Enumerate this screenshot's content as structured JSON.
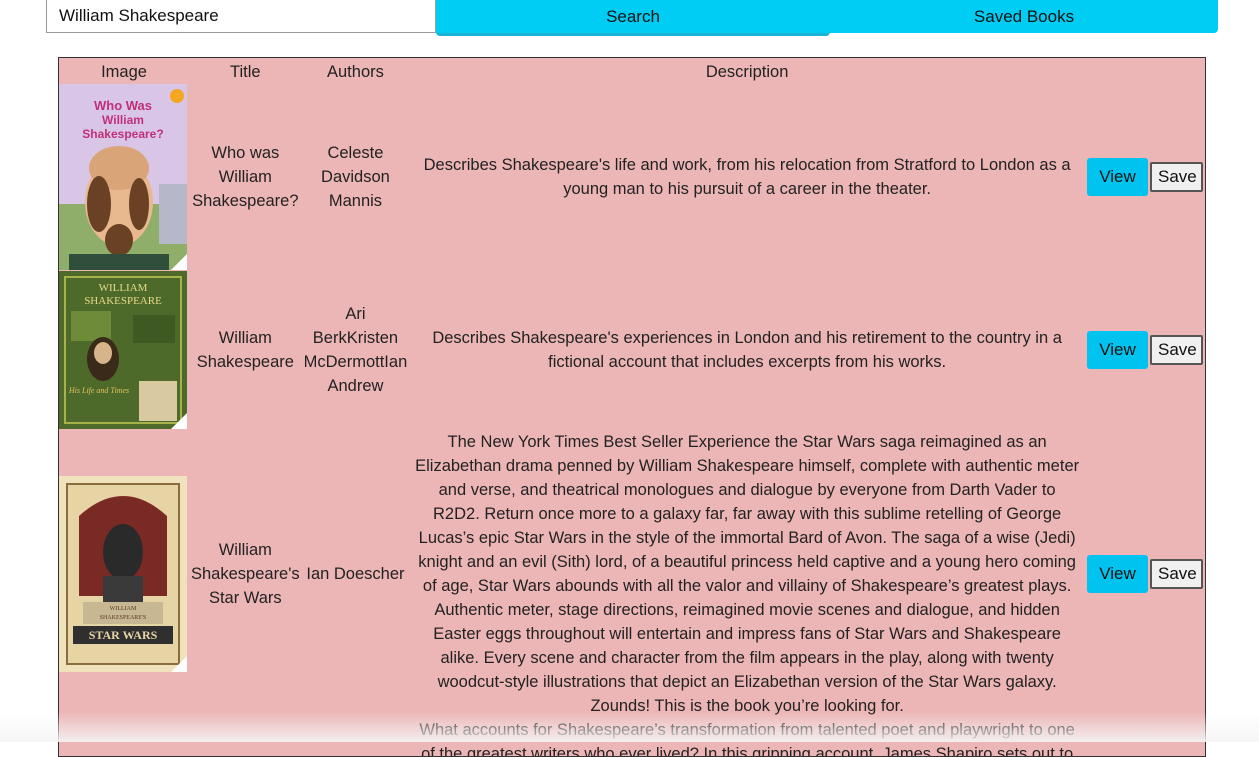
{
  "search": {
    "value": "William Shakespeare",
    "button_label": "Search"
  },
  "nav": {
    "saved_label": "Saved Books"
  },
  "table": {
    "headers": [
      "Image",
      "Title",
      "Authors",
      "Description"
    ],
    "rows": [
      {
        "title": "Who was William Shakespeare?",
        "authors": "Celeste Davidson Mannis",
        "description": "Describes Shakespeare's life and work, from his relocation from Stratford to London as a young man to his pursuit of a career in the theater.",
        "cover_text": "Who Was William Shakespeare?",
        "view_label": "View",
        "save_label": "Save"
      },
      {
        "title": "William Shakespeare",
        "authors": "Ari BerkKristen McDermottIan Andrew",
        "description": "Describes Shakespeare's experiences in London and his retirement to the country in a fictional account that includes excerpts from his works.",
        "cover_text": "William Shakespeare",
        "view_label": "View",
        "save_label": "Save"
      },
      {
        "title": "William Shakespeare's Star Wars",
        "authors": "Ian Doescher",
        "description": "The New York Times Best Seller Experience the Star Wars saga reimagined as an Elizabethan drama penned by William Shakespeare himself, complete with authentic meter and verse, and theatrical monologues and dialogue by everyone from Darth Vader to R2D2. Return once more to a galaxy far, far away with this sublime retelling of George Lucas’s epic Star Wars in the style of the immortal Bard of Avon. The saga of a wise (Jedi) knight and an evil (Sith) lord, of a beautiful princess held captive and a young hero coming of age, Star Wars abounds with all the valor and villainy of Shakespeare’s greatest plays. Authentic meter, stage directions, reimagined movie scenes and dialogue, and hidden Easter eggs throughout will entertain and impress fans of Star Wars and Shakespeare alike. Every scene and character from the film appears in the play, along with twenty woodcut-style illustrations that depict an Elizabethan version of the Star Wars galaxy. Zounds! This is the book you’re looking for.",
        "cover_text": "STAR WARS",
        "view_label": "View",
        "save_label": "Save"
      },
      {
        "title": "",
        "authors": "",
        "description": "What accounts for Shakespeare’s transformation from talented poet and playwright to one of the greatest writers who ever lived? In this gripping account, James Shapiro sets out to answer this",
        "view_label": "",
        "save_label": ""
      }
    ]
  },
  "colors": {
    "accent": "#00cdf3",
    "panel": "#edb6b6"
  }
}
